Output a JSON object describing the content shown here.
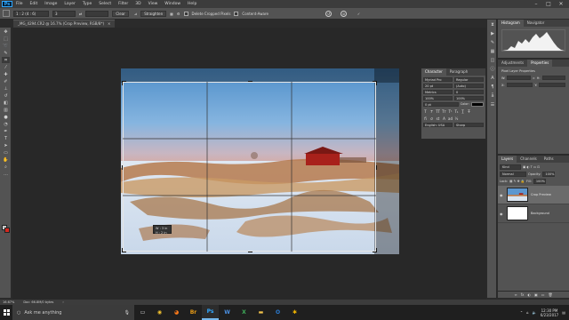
{
  "menubar": {
    "logo": "Ps",
    "items": [
      "File",
      "Edit",
      "Image",
      "Layer",
      "Type",
      "Select",
      "Filter",
      "3D",
      "View",
      "Window",
      "Help"
    ],
    "controls": [
      "–",
      "□",
      "✕"
    ]
  },
  "options": {
    "ratio_select": "1 : 2 (4 : 6)",
    "ratio_value": "3",
    "swap": "⇄",
    "clear": "Clear",
    "straighten": "Straighten",
    "delete_label": "Delete Cropped Pixels",
    "content_aware_label": "Content-Aware",
    "reset": "↺",
    "cancel": "⊘",
    "commit": "✓"
  },
  "document": {
    "tab_title": "_MG_4294.CR2 @ 16.7% (Crop Preview, RGB/8*)",
    "close": "×",
    "crop_tip_line1": "W : 3 in",
    "crop_tip_line2": "H : 2 in"
  },
  "character_panel": {
    "tabs": [
      "Character",
      "Paragraph"
    ],
    "font_family": "Myriad Pro",
    "font_style": "Regular",
    "font_size": "20 pt",
    "leading": "(Auto)",
    "kerning": "Metrics",
    "tracking": "0",
    "vscale": "100%",
    "hscale": "100%",
    "baseline": "0 pt",
    "color_label": "Color:",
    "language": "English: USA",
    "aa": "Sharp"
  },
  "histogram_panel": {
    "tabs": [
      "Histogram",
      "Navigator"
    ]
  },
  "properties_panel": {
    "tabs": [
      "Adjustments",
      "Properties"
    ],
    "title": "Pixel Layer Properties",
    "w_label": "W:",
    "h_label": "H:",
    "x_label": "X:",
    "y_label": "Y:"
  },
  "layers_panel": {
    "tabs": [
      "Layers",
      "Channels",
      "Paths"
    ],
    "kind": "Kind",
    "blend_mode": "Normal",
    "opacity_label": "Opacity:",
    "opacity_value": "100%",
    "lock_label": "Lock:",
    "fill_label": "Fill:",
    "fill_value": "100%",
    "layers": [
      {
        "name": "Crop Preview",
        "selected": true
      },
      {
        "name": "Background",
        "selected": false
      }
    ],
    "footer_icons": [
      "∞",
      "fx",
      "◐",
      "▣",
      "▭",
      "🗑"
    ]
  },
  "statusbar": {
    "zoom": "16.67%",
    "doc_size": "Doc: 66.8M/0 bytes",
    "arrow": "›"
  },
  "taskbar": {
    "search_placeholder": "Ask me anything",
    "apps": [
      {
        "name": "chrome",
        "glyph": "◉",
        "color": "#f2c230",
        "active": false
      },
      {
        "name": "firefox",
        "glyph": "◕",
        "color": "#ff7b1a",
        "active": false
      },
      {
        "name": "bridge",
        "glyph": "Br",
        "color": "#e69a16",
        "active": false
      },
      {
        "name": "photoshop",
        "glyph": "Ps",
        "color": "#31a8ff",
        "active": true
      },
      {
        "name": "word",
        "glyph": "W",
        "color": "#4a90e2",
        "active": false
      },
      {
        "name": "excel",
        "glyph": "X",
        "color": "#3fae5a",
        "active": false
      },
      {
        "name": "explorer",
        "glyph": "▬",
        "color": "#f3c44b",
        "active": false
      },
      {
        "name": "outlook",
        "glyph": "O",
        "color": "#2b7cd3",
        "active": false
      },
      {
        "name": "app-star",
        "glyph": "✱",
        "color": "#f0b400",
        "active": false
      }
    ],
    "time": "12:30 PM",
    "date": "6/23/2017"
  },
  "colors": {
    "accent": "#31a8ff",
    "background_swatch": "#d3281e",
    "foreground_swatch": "#c9c9c9"
  }
}
